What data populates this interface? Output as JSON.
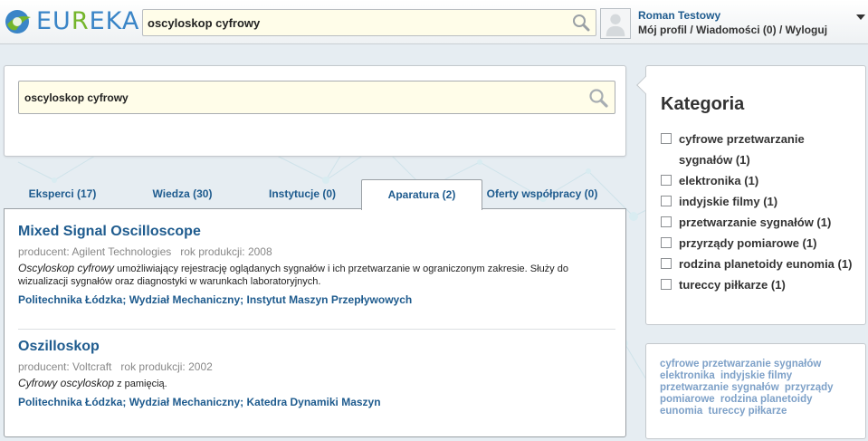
{
  "header": {
    "logo_text_blue_1": "EU",
    "logo_text_green": "R",
    "logo_text_blue_2": "EKA",
    "search_value": "oscyloskop cyfrowy",
    "user_name": "Roman Testowy",
    "links": [
      "Mój profil",
      "Wiadomości (0)",
      "Wyloguj"
    ]
  },
  "search": {
    "value": "oscyloskop cyfrowy"
  },
  "tabs": [
    {
      "label": "Eksperci (17)",
      "active": false
    },
    {
      "label": "Wiedza (30)",
      "active": false
    },
    {
      "label": "Instytucje (0)",
      "active": false
    },
    {
      "label": "Aparatura (2)",
      "active": true
    },
    {
      "label": "Oferty współpracy (0)",
      "active": false
    }
  ],
  "results": [
    {
      "title": "Mixed Signal Oscilloscope",
      "producer": "producent: Agilent Technologies",
      "year": "rok produkcji: 2008",
      "desc_em": "Oscyloskop cyfrowy",
      "desc_rest": " umożliwiający rejestrację oglądanych sygnałów i ich przetwarzanie w ograniczonym zakresie. Służy do wizualizacji sygnałów oraz diagnostyki w warunkach laboratoryjnych.",
      "affiliation": "Politechnika Łódzka; Wydział Mechaniczny; Instytut Maszyn Przepływowych"
    },
    {
      "title": "Oszilloskop",
      "producer": "producent: Voltcraft",
      "year": "rok produkcji: 2002",
      "desc_em": "Cyfrowy oscyloskop",
      "desc_rest": " z pamięcią.",
      "affiliation": "Politechnika Łódzka; Wydział Mechaniczny; Katedra Dynamiki Maszyn"
    }
  ],
  "categories": {
    "heading": "Kategoria",
    "items": [
      "cyfrowe przetwarzanie sygnałów (1)",
      "elektronika (1)",
      "indyjskie filmy (1)",
      "przetwarzanie sygnałów (1)",
      "przyrządy pomiarowe (1)",
      "rodzina planetoidy eunomia (1)",
      "tureccy piłkarze (1)"
    ]
  },
  "tag_cloud": [
    "cyfrowe przetwarzanie sygnałów",
    "elektronika",
    "indyjskie filmy",
    "przetwarzanie sygnałów",
    "przyrządy pomiarowe",
    "rodzina planetoidy eunomia",
    "tureccy piłkarze"
  ],
  "colors": {
    "link_blue": "#1e5b8e",
    "search_bg": "#fffde9",
    "tag_blue": "#7ea1c8",
    "page_bg": "#e6edf2"
  }
}
